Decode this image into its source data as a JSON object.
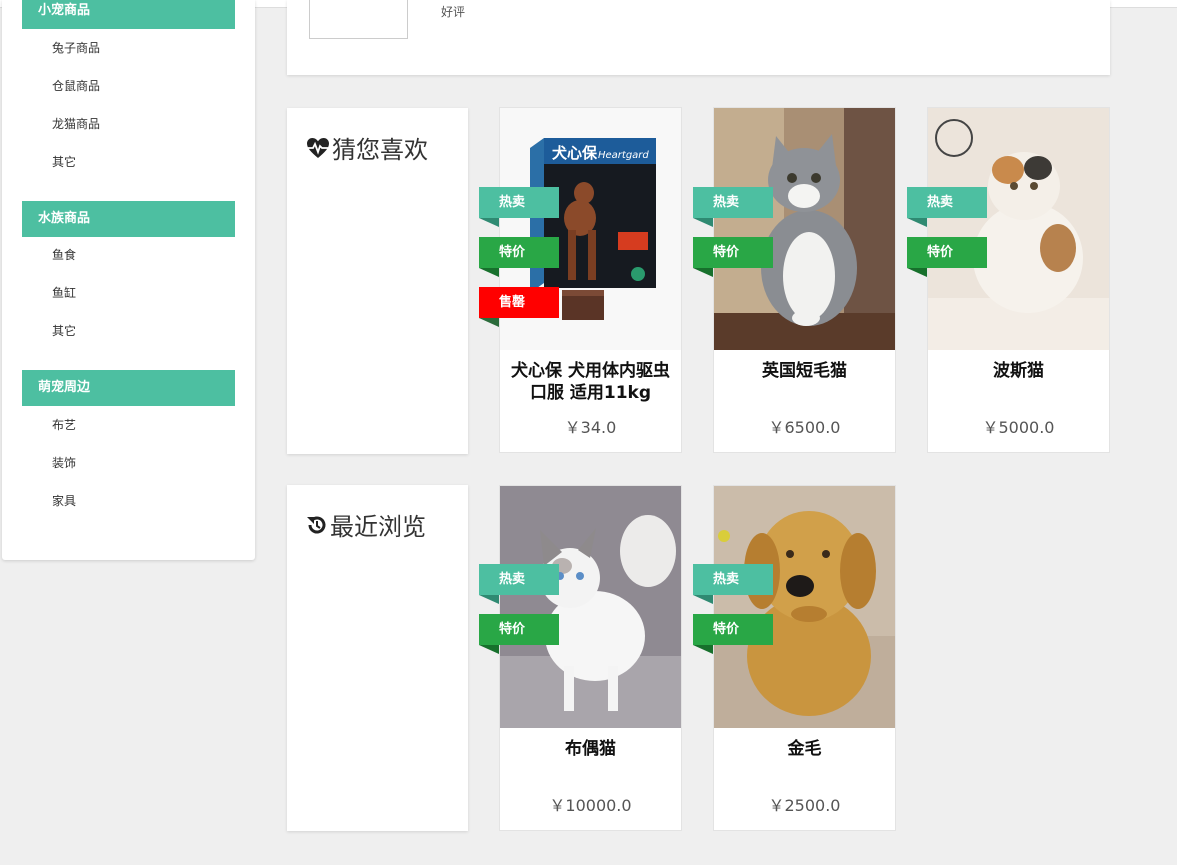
{
  "sidebar": {
    "categories": [
      {
        "title": "小宠商品",
        "items": [
          "兔子商品",
          "仓鼠商品",
          "龙猫商品",
          "其它"
        ]
      },
      {
        "title": "水族商品",
        "items": [
          "鱼食",
          "鱼缸",
          "其它"
        ]
      },
      {
        "title": "萌宠周边",
        "items": [
          "布艺",
          "装饰",
          "家具"
        ]
      }
    ]
  },
  "top_card": {
    "review_label": "好评"
  },
  "sections": {
    "guess": {
      "title": "猜您喜欢"
    },
    "recent": {
      "title": "最近浏览"
    }
  },
  "badges": {
    "hot": "热卖",
    "sale": "特价",
    "soldout": "售罄"
  },
  "products": {
    "guess": [
      {
        "name": "犬心保 犬用体内驱虫 口服 适用11kg",
        "price": "￥34.0"
      },
      {
        "name": "英国短毛猫",
        "price": "￥6500.0"
      },
      {
        "name": "波斯猫",
        "price": "￥5000.0"
      }
    ],
    "recent": [
      {
        "name": "布偶猫",
        "price": "￥10000.0"
      },
      {
        "name": "金毛",
        "price": "￥2500.0"
      }
    ]
  },
  "colors": {
    "accent": "#4dbfa1",
    "sale": "#29a746",
    "soldout": "#ff0000"
  }
}
